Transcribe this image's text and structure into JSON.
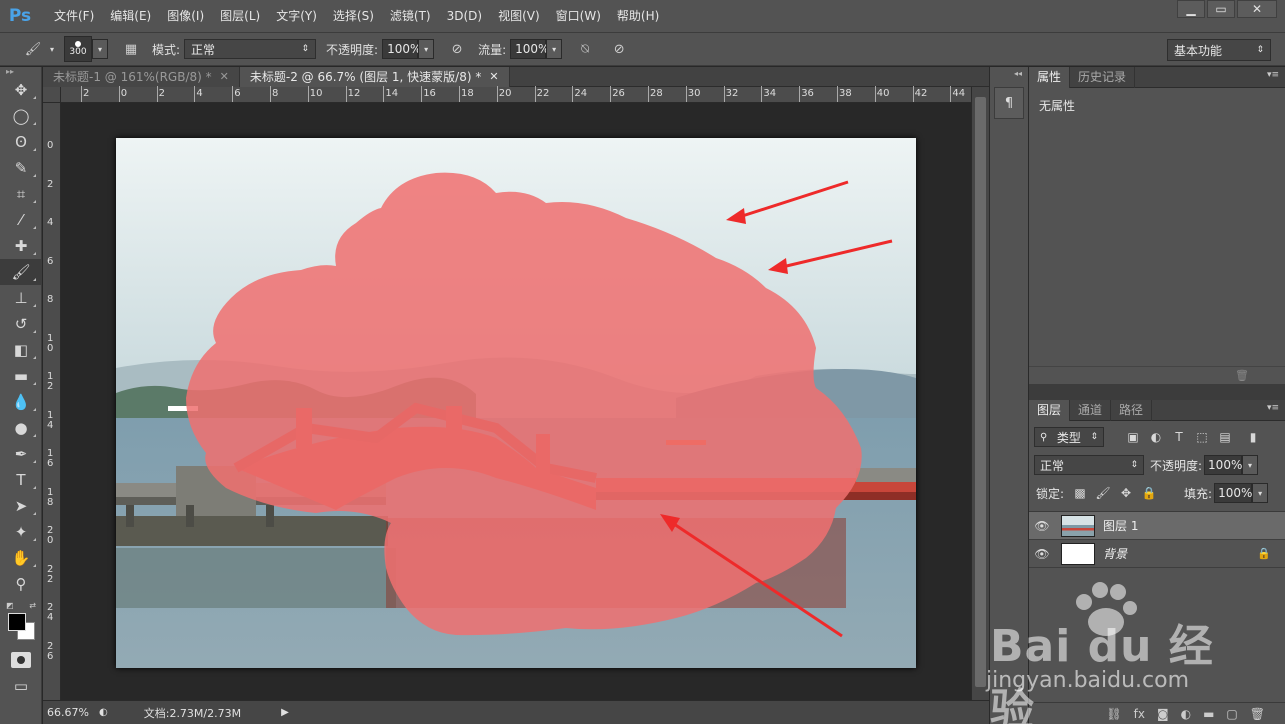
{
  "app": {
    "logo": "Ps",
    "menu": [
      "文件(F)",
      "编辑(E)",
      "图像(I)",
      "图层(L)",
      "文字(Y)",
      "选择(S)",
      "滤镜(T)",
      "3D(D)",
      "视图(V)",
      "窗口(W)",
      "帮助(H)"
    ]
  },
  "options": {
    "brush_size": "300",
    "mode_label": "模式:",
    "mode_value": "正常",
    "opacity_label": "不透明度:",
    "opacity_value": "100%",
    "flow_label": "流量:",
    "flow_value": "100%",
    "workspace": "基本功能"
  },
  "tabs": [
    {
      "label": "未标题-1 @ 161%(RGB/8) *",
      "active": false
    },
    {
      "label": "未标题-2 @ 66.7% (图层 1, 快速蒙版/8) *",
      "active": true
    }
  ],
  "ruler": {
    "top": [
      "2",
      "0",
      "2",
      "4",
      "6",
      "8",
      "10",
      "12",
      "14",
      "16",
      "18",
      "20",
      "22",
      "24",
      "26",
      "28",
      "30",
      "32",
      "34",
      "36",
      "38",
      "40",
      "42",
      "44"
    ],
    "left": [
      "0",
      "2",
      "4",
      "6",
      "8",
      "1 0",
      "1 2",
      "1 4",
      "1 6",
      "1 8",
      "2 0",
      "2 2",
      "2 4",
      "2 6"
    ]
  },
  "status": {
    "zoom": "66.67%",
    "doc": "文档:2.73M/2.73M"
  },
  "properties": {
    "tabs": [
      "属性",
      "历史记录"
    ],
    "empty_text": "无属性"
  },
  "layers": {
    "tabs": [
      "图层",
      "通道",
      "路径"
    ],
    "filter_label": "类型",
    "blend_mode": "正常",
    "opacity_label": "不透明度:",
    "opacity_value": "100%",
    "lock_label": "锁定:",
    "fill_label": "填充:",
    "fill_value": "100%",
    "items": [
      {
        "name": "图层 1",
        "selected": true
      },
      {
        "name": "背景",
        "selected": false
      }
    ]
  },
  "watermark": {
    "brand": "Bai du 经验",
    "url": "jingyan.baidu.com"
  },
  "colors": {
    "mask_red": "#f07070",
    "bridge_red": "#c8463a"
  }
}
